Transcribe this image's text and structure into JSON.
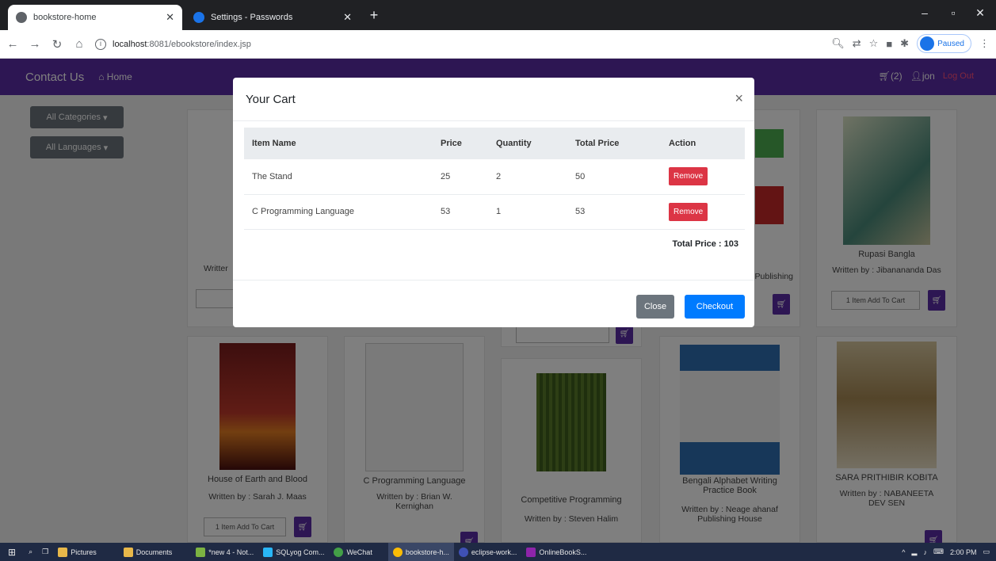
{
  "browser": {
    "tabs": [
      {
        "title": "bookstore-home",
        "active": true
      },
      {
        "title": "Settings - Passwords",
        "active": false
      }
    ],
    "url_host": "localhost",
    "url_rest": ":8081/ebookstore/index.jsp",
    "profile_status": "Paused"
  },
  "navbar": {
    "brand": "Contact Us",
    "home": "Home",
    "cart": "(2)",
    "user": "jon",
    "logout": "Log Out"
  },
  "filters": {
    "categories": "All Categories",
    "languages": "All Languages"
  },
  "books": [
    {
      "title": "",
      "author": "Writter"
    },
    {
      "title": "",
      "author": ""
    },
    {
      "title": "",
      "author": ""
    },
    {
      "title": "",
      "author": "Publishing"
    },
    {
      "title": "Rupasi Bangla",
      "author": "Written by : Jibanananda Das"
    },
    {
      "title": "House of Earth and Blood",
      "author": "Written by : Sarah J. Maas"
    },
    {
      "title": "C Programming Language",
      "author": "Written by : Brian W. Kernighan"
    },
    {
      "title": "Competitive Programming",
      "author": "Written by : Steven Halim"
    },
    {
      "title": "Bengali Alphabet Writing Practice Book",
      "author": "Written by : Neage ahanaf Publishing House"
    },
    {
      "title": "SARA PRITHIBIR KOBITA",
      "author": "Written by : NABANEETA DEV SEN"
    }
  ],
  "cart_button": "1 Item Add To Cart",
  "modal": {
    "title": "Your Cart",
    "columns": [
      "Item Name",
      "Price",
      "Quantity",
      "Total Price",
      "Action"
    ],
    "rows": [
      {
        "name": "The Stand",
        "price": "25",
        "quantity": "2",
        "total": "50",
        "action": "Remove"
      },
      {
        "name": "C Programming Language",
        "price": "53",
        "quantity": "1",
        "total": "53",
        "action": "Remove"
      }
    ],
    "total_label": "Total Price : 103",
    "close_label": "Close",
    "checkout_label": "Checkout"
  },
  "taskbar": {
    "items": [
      "Pictures",
      "Documents",
      "*new 4 - Not...",
      "SQLyog Com...",
      "WeChat",
      "bookstore-h...",
      "eclipse-work...",
      "OnlineBookS..."
    ],
    "time": "2:00 PM"
  },
  "colors": {
    "navbar": "#5b2ca6",
    "remove": "#dc3545",
    "checkout": "#007bff",
    "close": "#6c757d"
  }
}
